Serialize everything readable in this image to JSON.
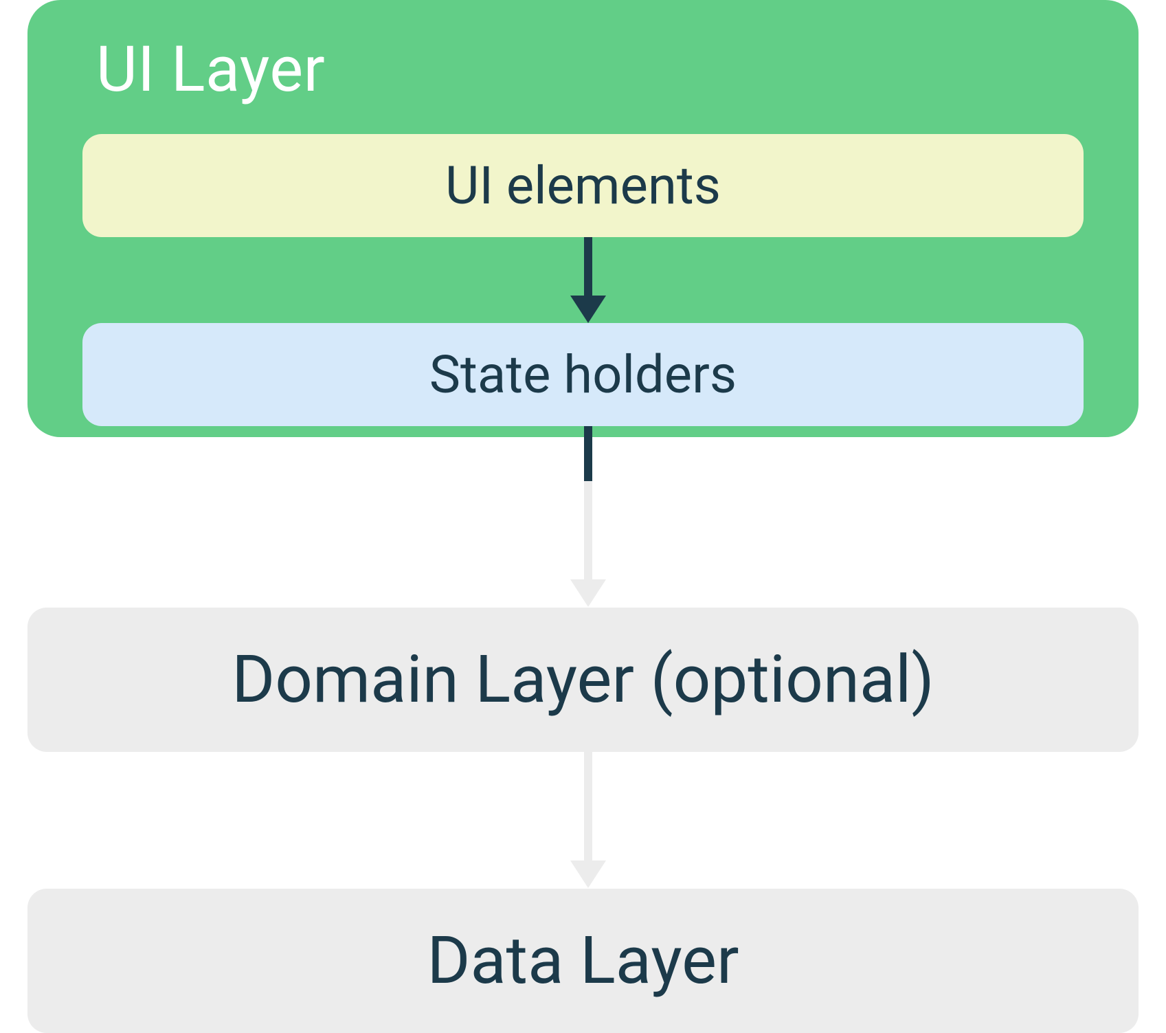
{
  "diagram": {
    "ui_layer": {
      "title": "UI Layer",
      "ui_elements_label": "UI elements",
      "state_holders_label": "State holders"
    },
    "domain_layer": {
      "label": "Domain Layer (optional)"
    },
    "data_layer": {
      "label": "Data Layer"
    }
  },
  "colors": {
    "ui_layer_bg": "#62ce87",
    "ui_elements_bg": "#f2f5cb",
    "state_holders_bg": "#d6e9fa",
    "layer_bg": "#ececec",
    "text_dark": "#1c3a4a",
    "text_light": "#ffffff",
    "arrow_dark": "#1c3a4a",
    "arrow_light": "#ececec"
  }
}
